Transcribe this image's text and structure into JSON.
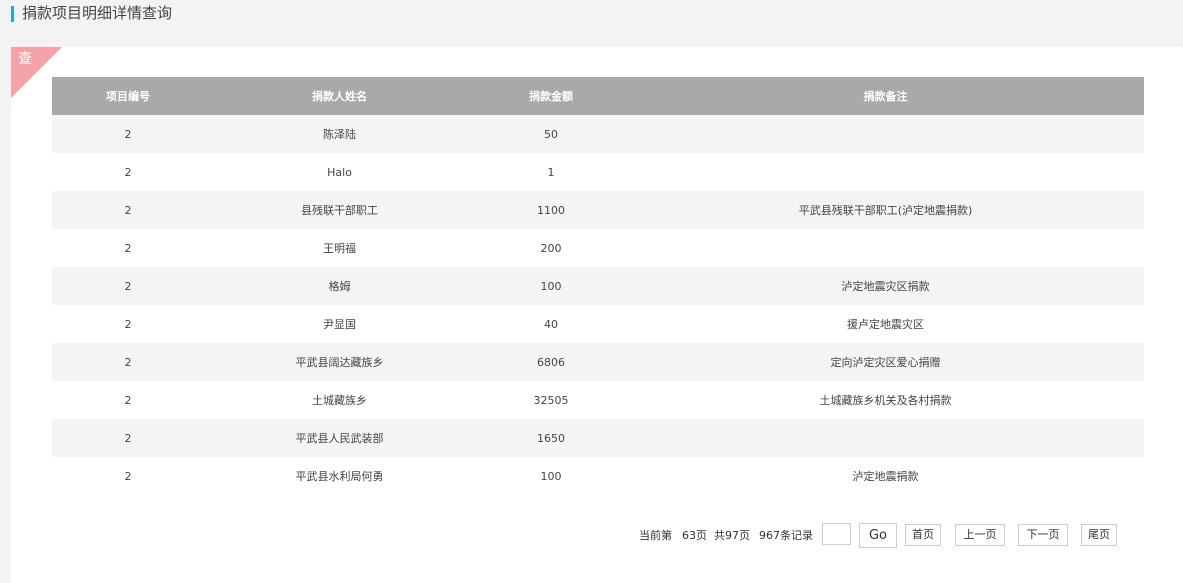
{
  "header": {
    "title": "捐款项目明细详情查询"
  },
  "panel": {
    "corner_label": "查"
  },
  "table": {
    "columns": [
      "项目编号",
      "捐款人姓名",
      "捐款金额",
      "捐款备注"
    ],
    "rows": [
      [
        "2",
        "陈泽陆",
        "50",
        ""
      ],
      [
        "2",
        "Halo",
        "1",
        ""
      ],
      [
        "2",
        "县残联干部职工",
        "1100",
        "平武县残联干部职工(泸定地震捐款)"
      ],
      [
        "2",
        "王明福",
        "200",
        ""
      ],
      [
        "2",
        "格姆",
        "100",
        "泸定地震灾区捐款"
      ],
      [
        "2",
        "尹显国",
        "40",
        "援卢定地震灾区"
      ],
      [
        "2",
        "平武县阔达藏族乡",
        "6806",
        "定向泸定灾区爱心捐赠"
      ],
      [
        "2",
        "土城藏族乡",
        "32505",
        "土城藏族乡机关及各村捐款"
      ],
      [
        "2",
        "平武县人民武装部",
        "1650",
        ""
      ],
      [
        "2",
        "平武县水利局何勇",
        "100",
        "泸定地震捐款"
      ]
    ]
  },
  "pager": {
    "current_label": "当前第",
    "current_page": "63页",
    "total_pages": "共97页",
    "total_records": "967条记录",
    "page_input_value": "",
    "go_label": "Go",
    "first_label": "首页",
    "prev_label": "上一页",
    "next_label": "下一页",
    "last_label": "尾页"
  },
  "colors": {
    "accent_bar": "#29a8d6",
    "corner": "#f5a3a8",
    "header_bg": "#a9a9a9",
    "stripe": "#f4f4f4"
  }
}
